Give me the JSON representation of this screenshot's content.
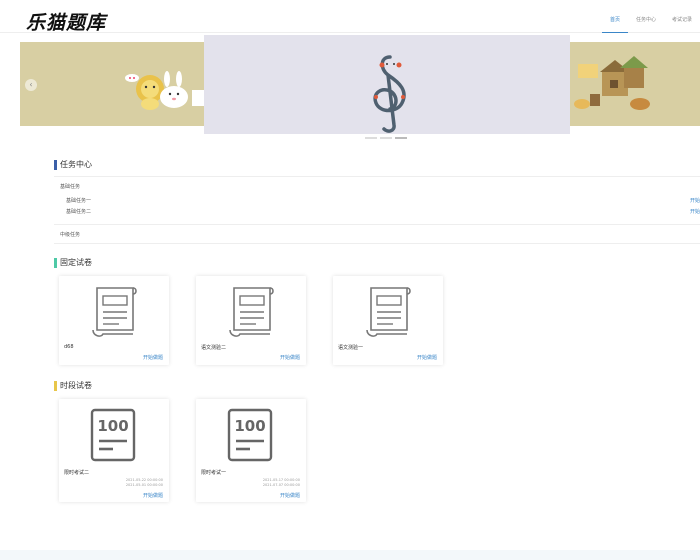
{
  "header": {
    "logo": "乐猫题库",
    "nav": [
      {
        "label": "首页",
        "active": true
      },
      {
        "label": "任务中心",
        "active": false
      },
      {
        "label": "考试记录",
        "active": false
      }
    ]
  },
  "carousel": {
    "arrow": "‹",
    "active_slide": 2,
    "slide_count": 3
  },
  "tasks": {
    "title": "任务中心",
    "basic_label": "基础任务",
    "items": [
      {
        "name": "基础任务一",
        "action": "开始"
      },
      {
        "name": "基础任务二",
        "action": "开始"
      }
    ],
    "mid_label": "中级任务"
  },
  "fixed": {
    "title": "固定试卷",
    "cards": [
      {
        "title": "d68",
        "start": "开始做题"
      },
      {
        "title": "语文测验二",
        "start": "开始做题"
      },
      {
        "title": "语文测验一",
        "start": "开始做题"
      }
    ]
  },
  "timed": {
    "title": "时段试卷",
    "cards": [
      {
        "title": "限时考试二",
        "time_start": "2021-05-22 00:00:00",
        "time_end": "2021-05-01 00:00:00",
        "start": "开始做题",
        "badge": "100"
      },
      {
        "title": "限时考试一",
        "time_start": "2021-05-17 00:00:00",
        "time_end": "2021-07-07 00:00:00",
        "start": "开始做题",
        "badge": "100"
      }
    ]
  },
  "colors": {
    "accent": "#3a86c8",
    "bar_task": "#3b5fa8",
    "bar_fixed": "#4ec9a6",
    "bar_timed": "#e8c64a"
  }
}
